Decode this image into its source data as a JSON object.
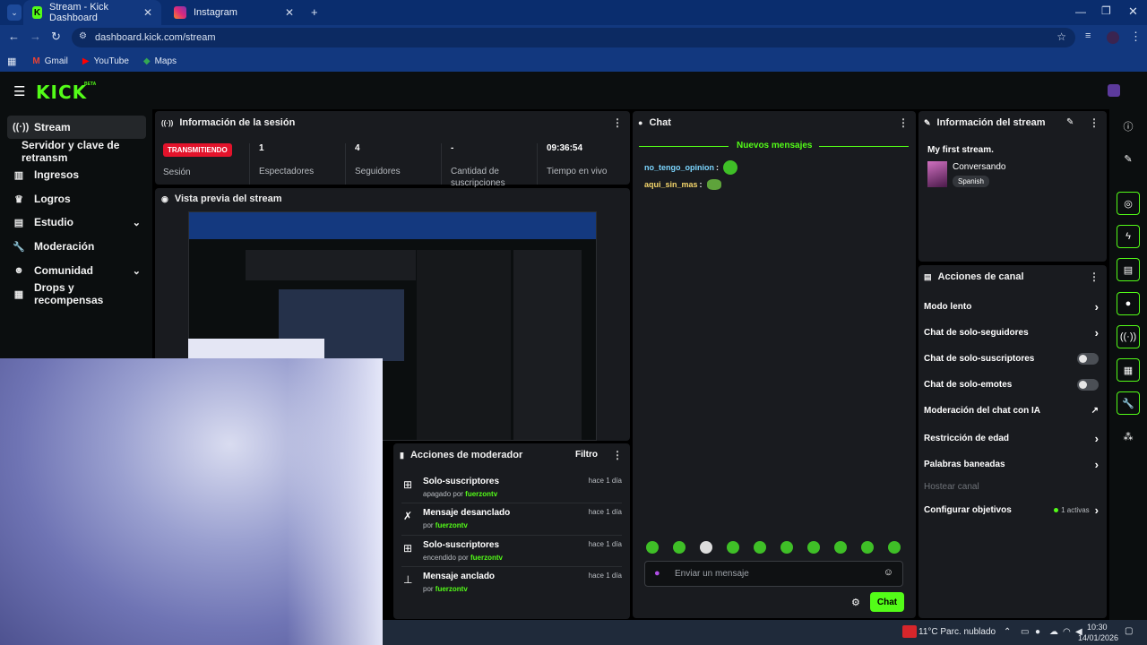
{
  "browser": {
    "tabs": [
      {
        "title": "Stream - Kick Dashboard",
        "icon": "kick-icon"
      },
      {
        "title": "Instagram",
        "icon": "instagram-icon"
      }
    ],
    "url": "dashboard.kick.com/stream",
    "bookmarks": [
      {
        "label": "Gmail",
        "icon": "gmail-icon"
      },
      {
        "label": "YouTube",
        "icon": "youtube-icon"
      },
      {
        "label": "Maps",
        "icon": "maps-icon"
      }
    ]
  },
  "header": {
    "logo": "KICK",
    "logo_badge": "BETA"
  },
  "sidebar": {
    "items": [
      {
        "label": "Stream",
        "icon": "broadcast-icon"
      },
      {
        "label": "Servidor y clave de retransm",
        "icon": ""
      },
      {
        "label": "Ingresos",
        "icon": "chart-icon"
      },
      {
        "label": "Logros",
        "icon": "trophy-icon"
      },
      {
        "label": "Estudio",
        "icon": "studio-icon"
      },
      {
        "label": "Moderación",
        "icon": "wrench-icon"
      },
      {
        "label": "Comunidad",
        "icon": "community-icon"
      },
      {
        "label": "Drops y recompensas",
        "icon": "drops-icon"
      }
    ]
  },
  "session": {
    "title": "Información de la sesión",
    "badge": "TRANSMITIENDO",
    "badge_label": "Sesión",
    "stats": [
      {
        "value": "1",
        "label": "Espectadores"
      },
      {
        "value": "4",
        "label": "Seguidores"
      },
      {
        "value": "-",
        "label": "Cantidad de suscripciones"
      },
      {
        "value": "09:36:54",
        "label": "Tiempo en vivo"
      }
    ]
  },
  "preview": {
    "title": "Vista previa del stream"
  },
  "chat": {
    "title": "Chat",
    "divider": "Nuevos mensajes",
    "messages": [
      {
        "user": "no_tengo_opinion",
        "text": ":"
      },
      {
        "user": "aqui_sin_mas",
        "text": ":"
      }
    ],
    "input_placeholder": "Enviar un mensaje",
    "send_label": "Chat"
  },
  "stream_info": {
    "title": "Información del stream",
    "stream_title": "My first stream.",
    "category": "Conversando",
    "language": "Spanish"
  },
  "channel_actions": {
    "title": "Acciones de canal",
    "items": [
      {
        "label": "Modo lento",
        "control": "arrow"
      },
      {
        "label": "Chat de solo-seguidores",
        "control": "arrow"
      },
      {
        "label": "Chat de solo-suscriptores",
        "control": "toggle"
      },
      {
        "label": "Chat de solo-emotes",
        "control": "toggle"
      },
      {
        "label": "Moderación del chat con IA",
        "control": "external"
      },
      {
        "label": "Restricción de edad",
        "control": "arrow"
      },
      {
        "label": "Palabras baneadas",
        "control": "arrow"
      },
      {
        "label": "Hostear canal",
        "control": "none"
      },
      {
        "label": "Configurar objetivos",
        "control": "arrow",
        "extra": "1 activas"
      }
    ]
  },
  "mod_actions": {
    "title": "Acciones de moderador",
    "filter": "Filtro",
    "items": [
      {
        "title": "Solo-suscriptores",
        "prefix": "apagado por",
        "user": "fuerzontv",
        "time": "hace 1 día",
        "icon": "gift-icon"
      },
      {
        "title": "Mensaje desanclado",
        "prefix": "por",
        "user": "fuerzontv",
        "time": "hace 1 día",
        "icon": "unpin-icon"
      },
      {
        "title": "Solo-suscriptores",
        "prefix": "encendido por",
        "user": "fuerzontv",
        "time": "hace 1 día",
        "icon": "gift-icon"
      },
      {
        "title": "Mensaje anclado",
        "prefix": "por",
        "user": "fuerzontv",
        "time": "hace 1 día",
        "icon": "pin-icon"
      }
    ]
  },
  "taskbar": {
    "weather": "11°C  Parc. nublado",
    "time": "10:30",
    "date": "14/01/2026"
  },
  "colors": {
    "accent": "#53fc18",
    "panel": "#191b1f",
    "live": "#e3132b"
  }
}
